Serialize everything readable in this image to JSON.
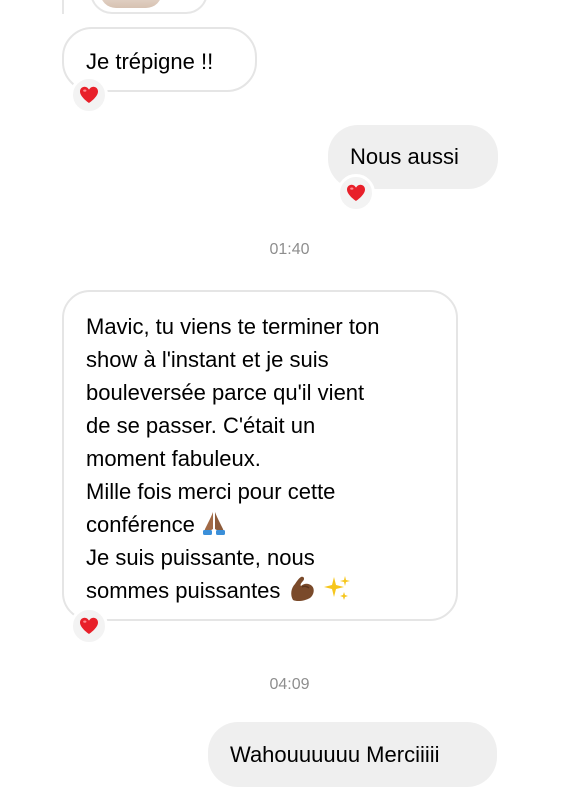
{
  "conversation": {
    "messages": [
      {
        "direction": "incoming",
        "text": "Je trépigne !!",
        "reaction": "heart-icon"
      },
      {
        "direction": "outgoing",
        "text": "Nous aussi",
        "reaction": "heart-icon"
      },
      {
        "direction": "incoming",
        "lines": [
          "Mavic, tu viens te terminer ton",
          "show à l'instant et je suis",
          "bouleversée parce qu'il vient",
          "de se passer. C'était un",
          "moment fabuleux.",
          "Mille fois merci pour  cette",
          "conférence",
          "Je suis puissante, nous",
          "sommes puissantes"
        ],
        "emojis": [
          "folded-hands-emoji",
          "flexed-biceps-emoji",
          "sparkles-emoji"
        ],
        "reaction": "heart-icon"
      },
      {
        "direction": "outgoing",
        "text": "Wahouuuuuu Merciiiii"
      }
    ],
    "timestamps": [
      "01:40",
      "04:09"
    ]
  },
  "colors": {
    "incoming_border": "#e5e5e5",
    "outgoing_bg": "#efefef",
    "timestamp": "#8e8e8e",
    "heart": "#e8202a"
  }
}
